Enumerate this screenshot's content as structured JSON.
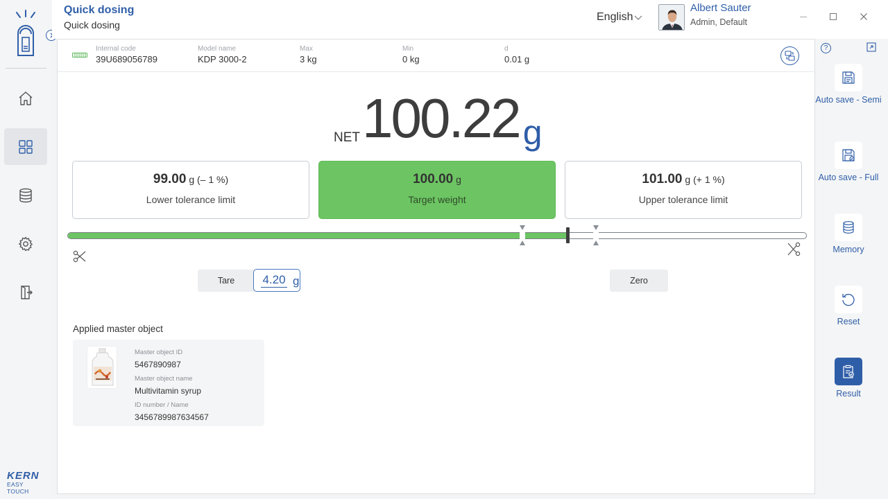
{
  "header": {
    "title": "Quick dosing",
    "subtitle": "Quick dosing",
    "language": "English",
    "user": {
      "name": "Albert Sauter",
      "role": "Admin, Default"
    }
  },
  "brand": {
    "name": "KERN",
    "tagline": "EASY TOUCH",
    "accent": "#2f5ea8",
    "ok_green": "#6cc562"
  },
  "nav": {
    "items": [
      {
        "icon": "home-icon"
      },
      {
        "icon": "apps-grid-icon",
        "active": true
      },
      {
        "icon": "database-icon"
      },
      {
        "icon": "settings-gear-icon"
      },
      {
        "icon": "logout-icon"
      }
    ]
  },
  "device": {
    "internal_code": {
      "label": "Internal code",
      "value": "39U689056789"
    },
    "model_name": {
      "label": "Model name",
      "value": "KDP 3000-2"
    },
    "max": {
      "label": "Max",
      "value": "3 kg"
    },
    "min": {
      "label": "Min",
      "value": "0 kg"
    },
    "d": {
      "label": "d",
      "value": "0.01 g"
    }
  },
  "weight": {
    "prefix": "NET",
    "value": "100.22",
    "unit": "g"
  },
  "tolerance": {
    "lower": {
      "value": "99.00",
      "unit": "g",
      "pct": "(– 1 %)",
      "label": "Lower tolerance limit"
    },
    "target": {
      "value": "100.00",
      "unit": "g",
      "label": "Target weight"
    },
    "upper": {
      "value": "101.00",
      "unit": "g",
      "pct": "(+ 1 %)",
      "label": "Upper tolerance limit"
    }
  },
  "progress": {
    "fill_fraction": 0.676,
    "marker_fraction": 0.676,
    "lower_fraction": 0.615,
    "upper_fraction": 0.715
  },
  "controls": {
    "tare_label": "Tare",
    "tare_value": "4.20",
    "tare_unit": "g",
    "zero_label": "Zero"
  },
  "master": {
    "section_title": "Applied master object",
    "id_label": "Master object ID",
    "id_value": "5467890987",
    "name_label": "Master object name",
    "name_value": "Multivitamin syrup",
    "idnum_label": "ID number / Name",
    "idnum_value": "3456789987634567"
  },
  "right_panel": {
    "items": [
      {
        "label": "Auto save - Semi",
        "icon": "floppy-semi-icon"
      },
      {
        "label": "Auto save - Full",
        "icon": "floppy-full-icon"
      },
      {
        "label": "Memory",
        "icon": "memory-database-icon"
      },
      {
        "label": "Reset",
        "icon": "reset-icon"
      },
      {
        "label": "Result",
        "icon": "result-clipboard-icon",
        "active": true
      }
    ]
  }
}
